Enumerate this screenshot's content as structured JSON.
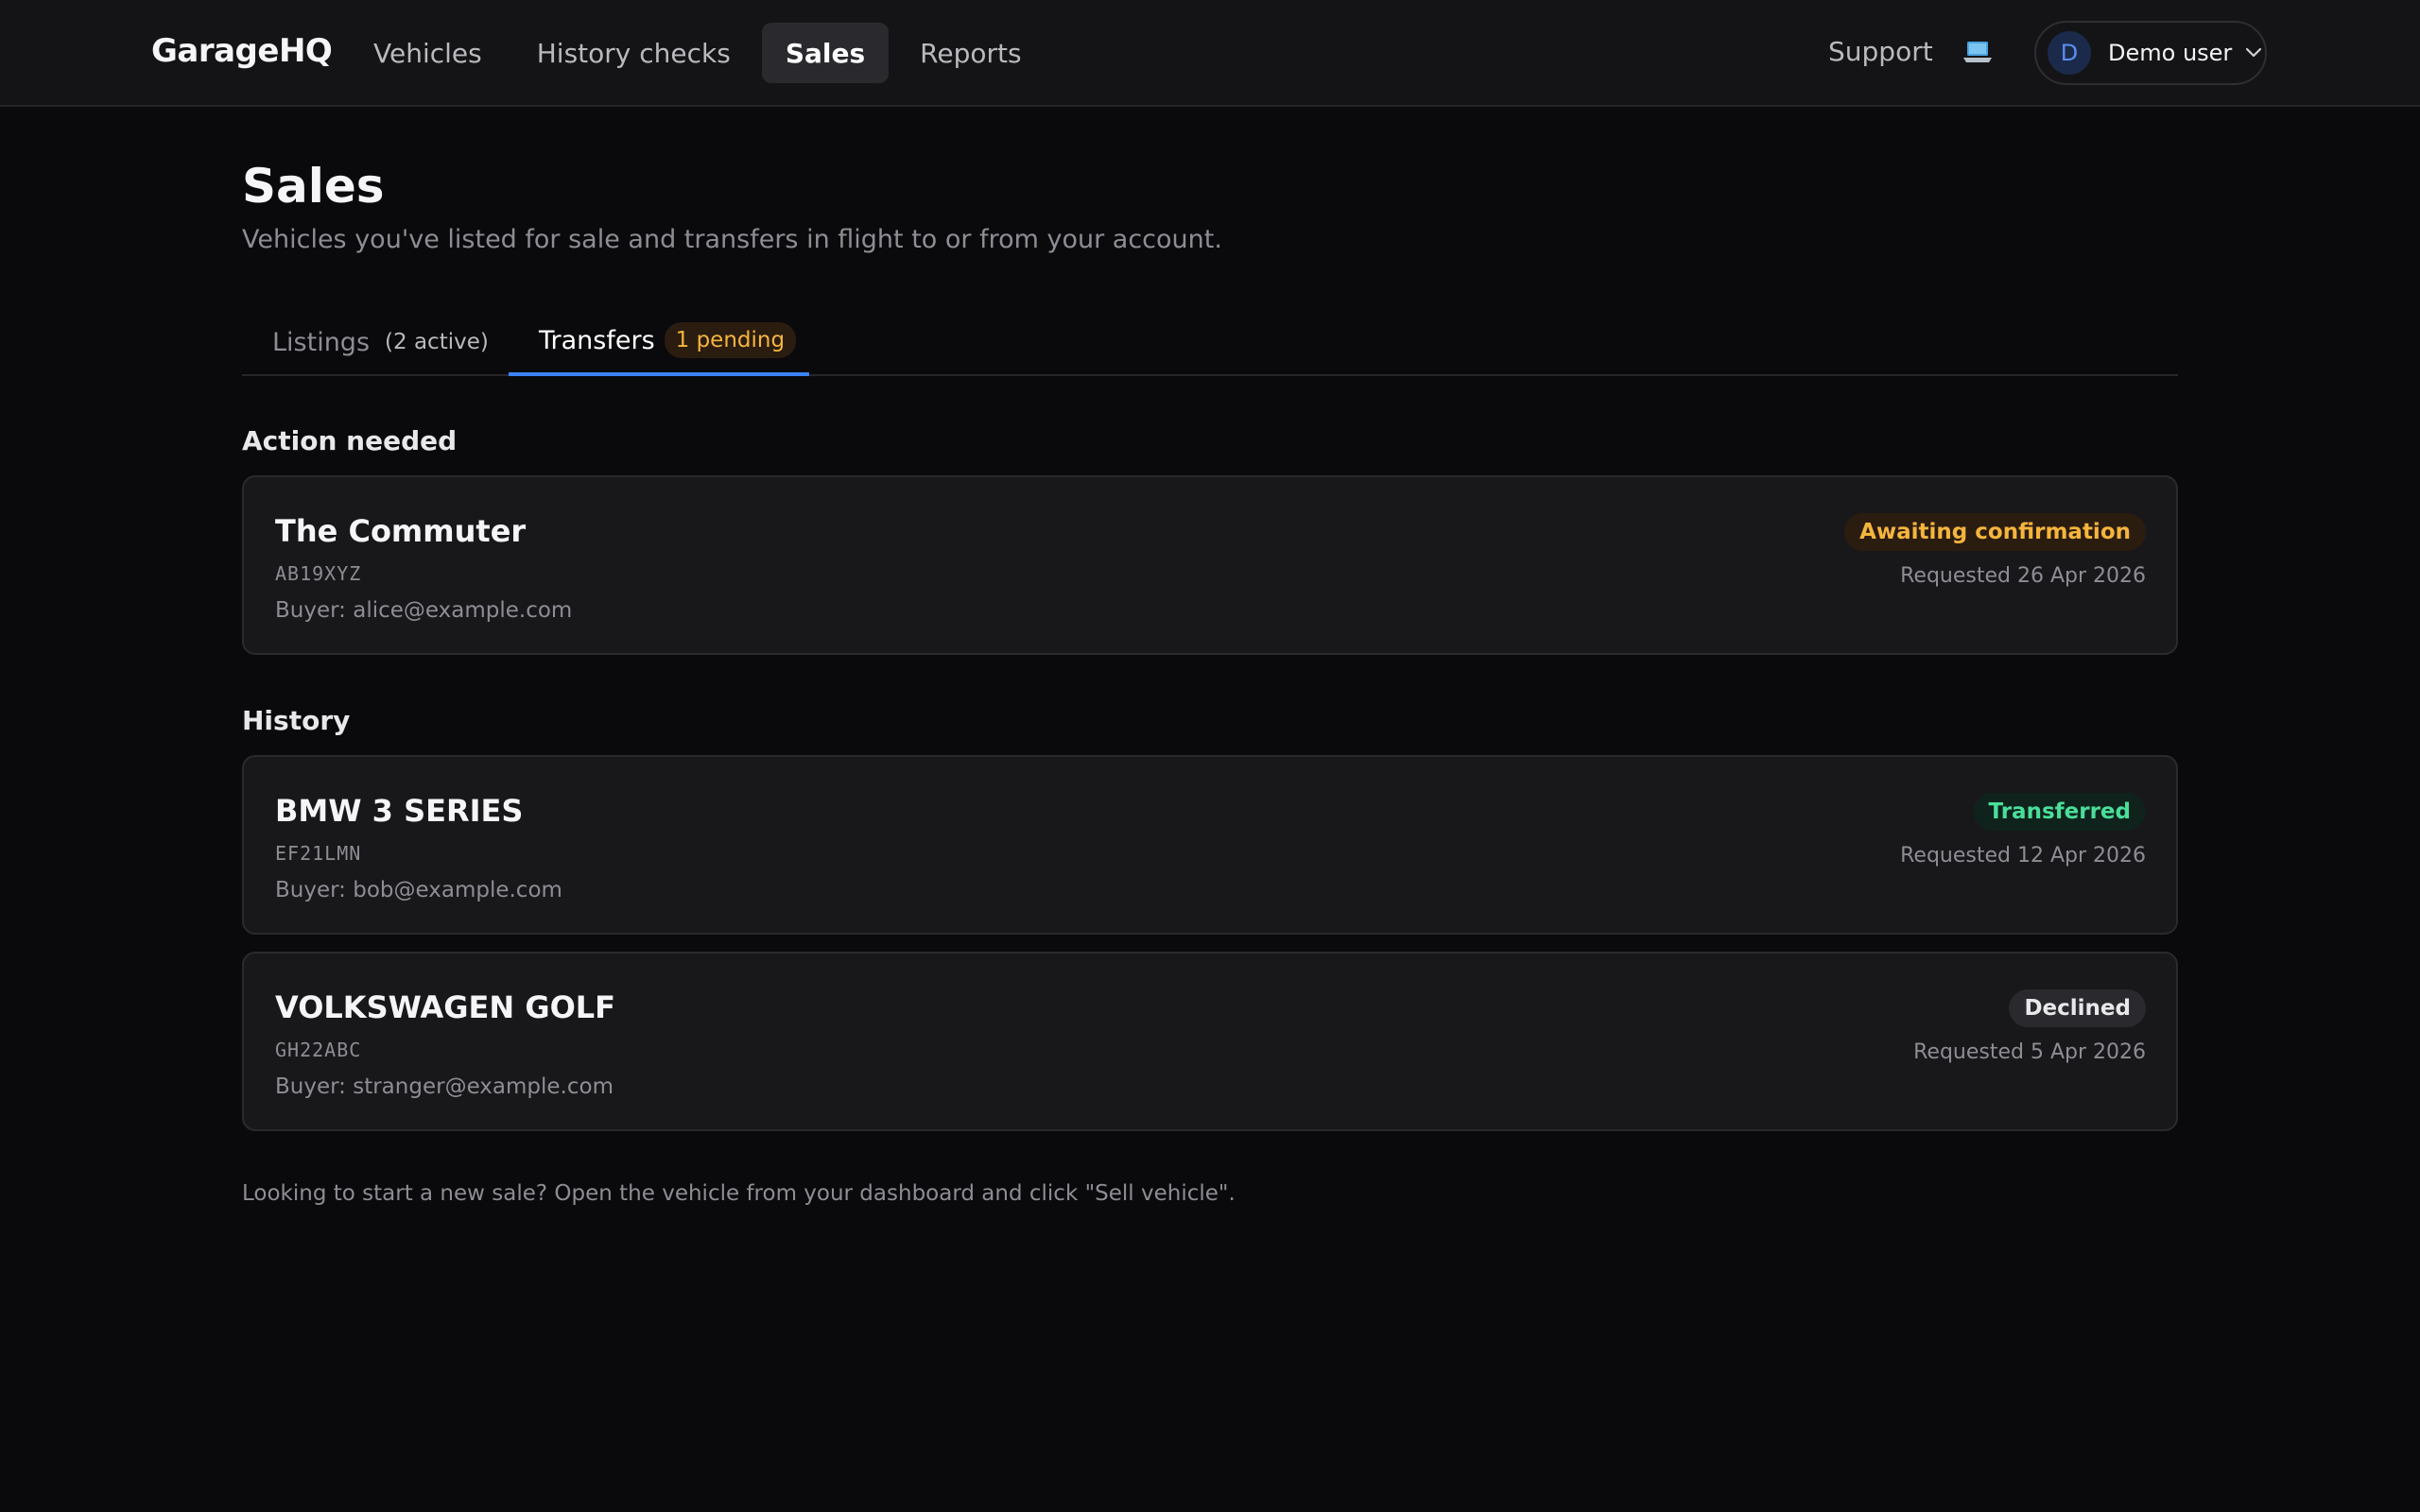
{
  "app": {
    "brand": "GarageHQ"
  },
  "nav": {
    "items": [
      {
        "label": "Vehicles"
      },
      {
        "label": "History checks"
      },
      {
        "label": "Sales",
        "active": true
      },
      {
        "label": "Reports"
      }
    ],
    "support_label": "Support",
    "device_icon": "laptop-icon"
  },
  "user": {
    "initial": "D",
    "name": "Demo user"
  },
  "page": {
    "title": "Sales",
    "subtitle": "Vehicles you've listed for sale and transfers in flight to or from your account."
  },
  "tabs": {
    "listings": {
      "label": "Listings",
      "count": "(2 active)"
    },
    "transfers": {
      "label": "Transfers",
      "badge": "1 pending",
      "active": true
    }
  },
  "action_needed": {
    "heading": "Action needed",
    "items": [
      {
        "title": "The Commuter",
        "registration": "AB19XYZ",
        "buyer": "Buyer: alice@example.com",
        "status": "Awaiting confirmation",
        "requested": "Requested 26 Apr 2026"
      }
    ]
  },
  "history": {
    "heading": "History",
    "items": [
      {
        "title": "BMW 3 SERIES",
        "registration": "EF21LMN",
        "buyer": "Buyer: bob@example.com",
        "status": "Transferred",
        "requested": "Requested 12 Apr 2026"
      },
      {
        "title": "VOLKSWAGEN GOLF",
        "registration": "GH22ABC",
        "buyer": "Buyer: stranger@example.com",
        "status": "Declined",
        "requested": "Requested 5 Apr 2026"
      }
    ]
  },
  "footer_note": "Looking to start a new sale? Open the vehicle from your dashboard and click \"Sell vehicle\".",
  "colors": {
    "background": "#0a0a0c",
    "accent": "#3b82f6",
    "pending": "#f5b53d",
    "success": "#4ade9a"
  }
}
